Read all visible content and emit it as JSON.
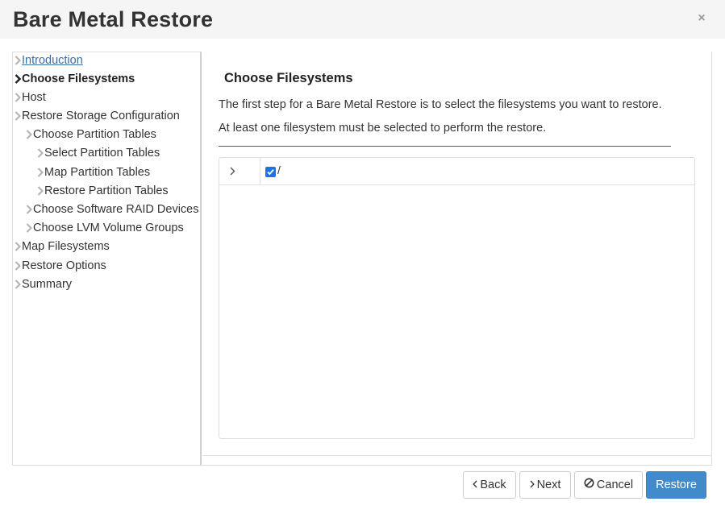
{
  "dialog": {
    "title": "Bare Metal Restore",
    "close_symbol": "×"
  },
  "sidebar": {
    "items": [
      {
        "label": "Introduction",
        "state": "link"
      },
      {
        "label": "Choose Filesystems",
        "state": "current"
      },
      {
        "label": "Host",
        "state": "normal"
      },
      {
        "label": "Restore Storage Configuration",
        "state": "normal"
      },
      {
        "label": "Choose Partition Tables",
        "state": "normal"
      },
      {
        "label": "Select Partition Tables",
        "state": "normal"
      },
      {
        "label": "Map Partition Tables",
        "state": "normal"
      },
      {
        "label": "Restore Partition Tables",
        "state": "normal"
      },
      {
        "label": "Choose Software RAID Devices",
        "state": "normal"
      },
      {
        "label": "Choose LVM Volume Groups",
        "state": "normal"
      },
      {
        "label": "Map Filesystems",
        "state": "normal"
      },
      {
        "label": "Restore Options",
        "state": "normal"
      },
      {
        "label": "Summary",
        "state": "normal"
      }
    ]
  },
  "content": {
    "heading": "Choose Filesystems",
    "paragraph1": "The first step for a Bare Metal Restore is to select the filesystems you want to restore.",
    "paragraph2": "At least one filesystem must be selected to perform the restore.",
    "filesystems": [
      {
        "name": "/",
        "checked": true
      }
    ]
  },
  "footer": {
    "back_label": "Back",
    "next_label": "Next",
    "cancel_label": "Cancel",
    "restore_label": "Restore"
  },
  "colors": {
    "accent": "#428bca",
    "checkbox": "#1a73e8",
    "link": "#3a6ea5",
    "header_bg": "#f5f5f5"
  },
  "icons": {
    "nav": "chevron-right-icon",
    "expander": "chevron-right-icon",
    "back": "chevron-left-icon",
    "next": "chevron-right-icon",
    "cancel": "ban-icon",
    "close": "close-icon",
    "checkbox": "checkmark-icon"
  }
}
